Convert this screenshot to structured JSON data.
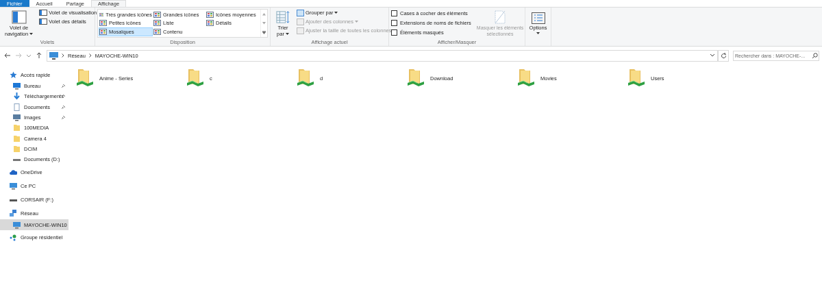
{
  "tabs": [
    {
      "label": "Fichier",
      "kind": "file",
      "selected": false
    },
    {
      "label": "Accueil",
      "kind": "normal",
      "selected": false
    },
    {
      "label": "Partage",
      "kind": "normal",
      "selected": false
    },
    {
      "label": "Affichage",
      "kind": "normal",
      "selected": true
    }
  ],
  "volets": {
    "navigation": {
      "label_1": "Volet de",
      "label_2": "navigation"
    },
    "items": [
      {
        "label": "Volet de visualisation"
      },
      {
        "label": "Volet des détails"
      }
    ],
    "group_label": "Volets"
  },
  "disposition": {
    "layouts": [
      {
        "label": "Très grandes icônes",
        "selected": false
      },
      {
        "label": "Grandes icônes",
        "selected": false
      },
      {
        "label": "Icônes moyennes",
        "selected": false
      },
      {
        "label": "Petites icônes",
        "selected": false
      },
      {
        "label": "Liste",
        "selected": false
      },
      {
        "label": "Détails",
        "selected": false
      },
      {
        "label": "Mosaïques",
        "selected": true
      },
      {
        "label": "Contenu",
        "selected": false
      }
    ],
    "group_label": "Disposition"
  },
  "affichage_actuel": {
    "sort": {
      "label_1": "Trier",
      "label_2": "par"
    },
    "items": [
      {
        "label": "Grouper par",
        "disabled": false,
        "caret": true
      },
      {
        "label": "Ajouter des colonnes",
        "disabled": true,
        "caret": true
      },
      {
        "label": "Ajuster la taille de toutes les colonnes",
        "disabled": true,
        "caret": false
      }
    ],
    "group_label": "Affichage actuel"
  },
  "afficher_masquer": {
    "checkboxes": [
      {
        "label": "Cases à cocher des éléments",
        "checked": false
      },
      {
        "label": "Extensions de noms de fichiers",
        "checked": false
      },
      {
        "label": "Éléments masqués",
        "checked": false
      }
    ],
    "hide_button": {
      "label_1": "Masquer les éléments",
      "label_2": "sélectionnés",
      "disabled": true
    },
    "group_label": "Afficher/Masquer"
  },
  "options": {
    "label": "Options"
  },
  "address": {
    "crumbs": [
      "Réseau",
      "MAYOCHE-WIN10"
    ]
  },
  "search": {
    "placeholder": "Rechercher dans : MAYOCHE-..."
  },
  "sidebar": {
    "items": [
      {
        "label": "Accès rapide",
        "kind": "star",
        "selected": false,
        "children": [
          {
            "label": "Bureau",
            "kind": "desktop",
            "pinned": true,
            "selected": false
          },
          {
            "label": "Téléchargements",
            "kind": "download",
            "pinned": true,
            "selected": false
          },
          {
            "label": "Documents",
            "kind": "document",
            "pinned": true,
            "selected": false
          },
          {
            "label": "Images",
            "kind": "image",
            "pinned": true,
            "selected": false
          },
          {
            "label": "100MEDIA",
            "kind": "folder",
            "pinned": false,
            "selected": false
          },
          {
            "label": "Camera 4",
            "kind": "folder",
            "pinned": false,
            "selected": false
          },
          {
            "label": "DCIM",
            "kind": "folder",
            "pinned": false,
            "selected": false
          },
          {
            "label": "Documents (D:)",
            "kind": "drive",
            "pinned": false,
            "selected": false
          }
        ]
      },
      {
        "label": "OneDrive",
        "kind": "cloud",
        "selected": false
      },
      {
        "label": "Ce PC",
        "kind": "pc",
        "selected": false
      },
      {
        "label": "CORSAIR (F:)",
        "kind": "usb",
        "selected": false
      },
      {
        "label": "Réseau",
        "kind": "network",
        "selected": false,
        "children": [
          {
            "label": "MAYOCHE-WIN10",
            "kind": "pc",
            "selected": true
          }
        ]
      },
      {
        "label": "Groupe résidentiel",
        "kind": "homegroup",
        "selected": false
      }
    ]
  },
  "folders": [
    {
      "label": "Anime - Series"
    },
    {
      "label": "c"
    },
    {
      "label": "d"
    },
    {
      "label": "Download"
    },
    {
      "label": "Movies"
    },
    {
      "label": "Users"
    }
  ]
}
